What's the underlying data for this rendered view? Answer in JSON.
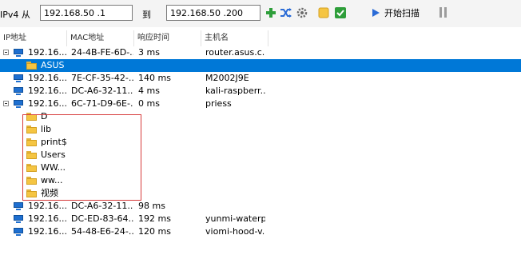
{
  "toolbar": {
    "ipv4_label": "IPv4 从",
    "start_ip": "192.168.50 .1",
    "to_label": "到",
    "end_ip": "192.168.50 .200",
    "scan_label": "开始扫描",
    "icons": [
      "plus-icon",
      "shuffle-icon",
      "settings-gear-icon",
      "note-icon",
      "check-icon",
      "play-icon",
      "pause-icon"
    ]
  },
  "columns": [
    "IP地址",
    "MAC地址",
    "响应时间",
    "主机名"
  ],
  "rows": [
    {
      "type": "host",
      "ip": "192.16...",
      "mac": "24-4B-FE-6D-...",
      "time": "3 ms",
      "host": "router.asus.c..."
    },
    {
      "type": "share",
      "name": "ASUS",
      "selected": true
    },
    {
      "type": "host",
      "ip": "192.16...",
      "mac": "7E-CF-35-42-...",
      "time": "140 ms",
      "host": "M2002J9E"
    },
    {
      "type": "host",
      "ip": "192.16...",
      "mac": "DC-A6-32-11...",
      "time": "4 ms",
      "host": "kali-raspberr..."
    },
    {
      "type": "host",
      "ip": "192.16...",
      "mac": "6C-71-D9-6E-...",
      "time": "0 ms",
      "host": "priess"
    },
    {
      "type": "share",
      "name": "D"
    },
    {
      "type": "share",
      "name": "lib"
    },
    {
      "type": "share",
      "name": "print$"
    },
    {
      "type": "share",
      "name": "Users"
    },
    {
      "type": "share",
      "name": "WW..."
    },
    {
      "type": "share",
      "name": "ww..."
    },
    {
      "type": "share",
      "name": "视频"
    },
    {
      "type": "host",
      "ip": "192.16...",
      "mac": "DC-A6-32-11...",
      "time": "98 ms",
      "host": ""
    },
    {
      "type": "host",
      "ip": "192.16...",
      "mac": "DC-ED-83-64...",
      "time": "192 ms",
      "host": "yunmi-waterp..."
    },
    {
      "type": "host",
      "ip": "192.16...",
      "mac": "54-48-E6-24-...",
      "time": "120 ms",
      "host": "viomi-hood-v..."
    }
  ],
  "colors": {
    "selected": "#0078d7",
    "accent_green": "#2e9e3a",
    "highlight_box": "#d63b3b"
  }
}
